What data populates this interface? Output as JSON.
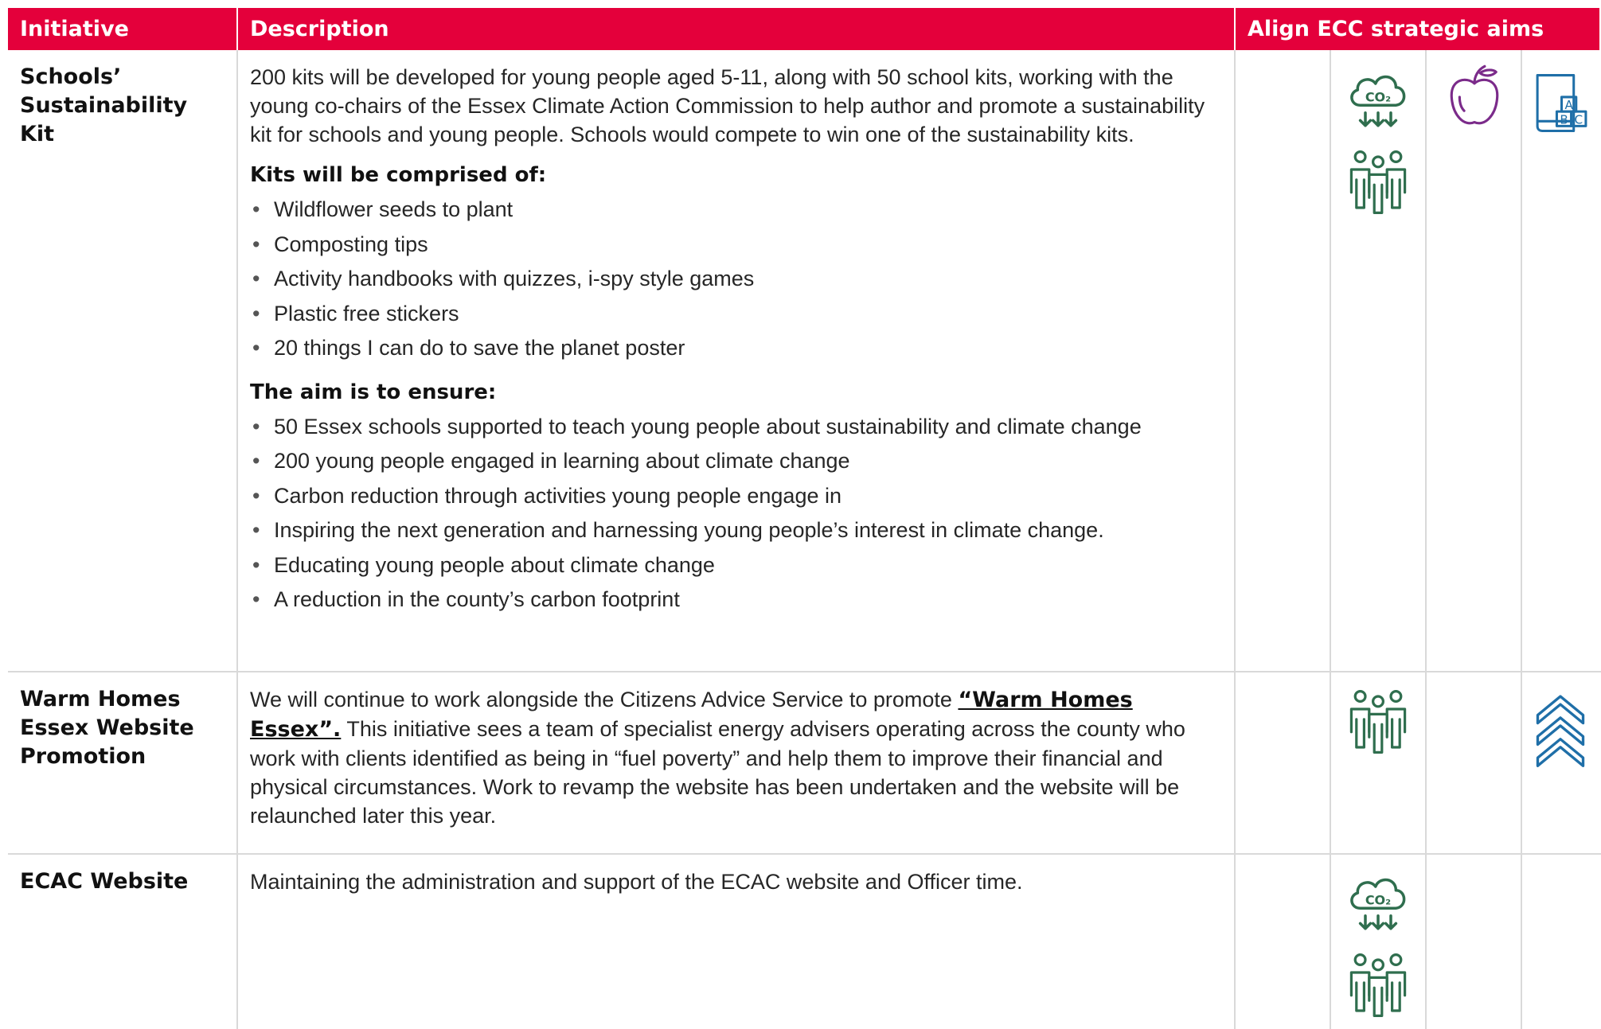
{
  "header": {
    "initiative": "Initiative",
    "description": "Description",
    "aims": "Align ECC strategic aims"
  },
  "rows": [
    {
      "initiative": "Schools’ Sustainability Kit",
      "description": "200 kits will be developed for young people aged 5-11, along with 50 school kits, working with the young co-chairs of the Essex Climate Action Commission to help author and promote a sustainability kit for schools and young people. Schools would compete to win one of the sustainability kits.",
      "kits_heading": "Kits will be comprised of:",
      "kits": [
        "Wildflower seeds to plant",
        "Composting tips",
        "Activity handbooks with quizzes, i-spy style games",
        "Plastic free stickers",
        "20 things I can do to save the planet poster"
      ],
      "aim_heading": "The aim is to ensure:",
      "aims": [
        "50 Essex schools supported to teach young people about sustainability and climate change",
        "200 young people engaged in learning about climate change",
        "Carbon reduction through activities young people engage in",
        "Inspiring the next generation and harnessing young people’s interest in climate change.",
        "Educating young people about climate change",
        "A reduction in the county’s carbon footprint"
      ],
      "icons": [
        "co2-cloud-icon",
        "people-group-icon",
        "apple-icon",
        "abc-book-icon"
      ]
    },
    {
      "initiative": "Warm Homes Essex Website Promotion",
      "description_before": "We will continue to work alongside the Citizens Advice Service to promote ",
      "description_link": "“Warm Homes Essex”.",
      "description_after": " This initiative sees a team of specialist energy advisers operating across the county who work with clients identified as being in “fuel poverty” and help them to improve their financial and physical circumstances. Work to revamp the website has been undertaken and the website will be relaunched later this year.",
      "icons": [
        "people-group-icon",
        "chevrons-up-icon"
      ]
    },
    {
      "initiative": "ECAC Website",
      "description": "Maintaining the administration and support of the ECAC website and Officer time.",
      "icons": [
        "co2-cloud-icon",
        "people-group-icon"
      ]
    }
  ],
  "colors": {
    "header_bg": "#e4003b",
    "header_text": "#ffffff",
    "green_icon": "#2f6e4e",
    "purple_icon": "#7b2b8a",
    "blue_icon": "#1f6fa8",
    "grid_line": "#d9d9d9"
  }
}
